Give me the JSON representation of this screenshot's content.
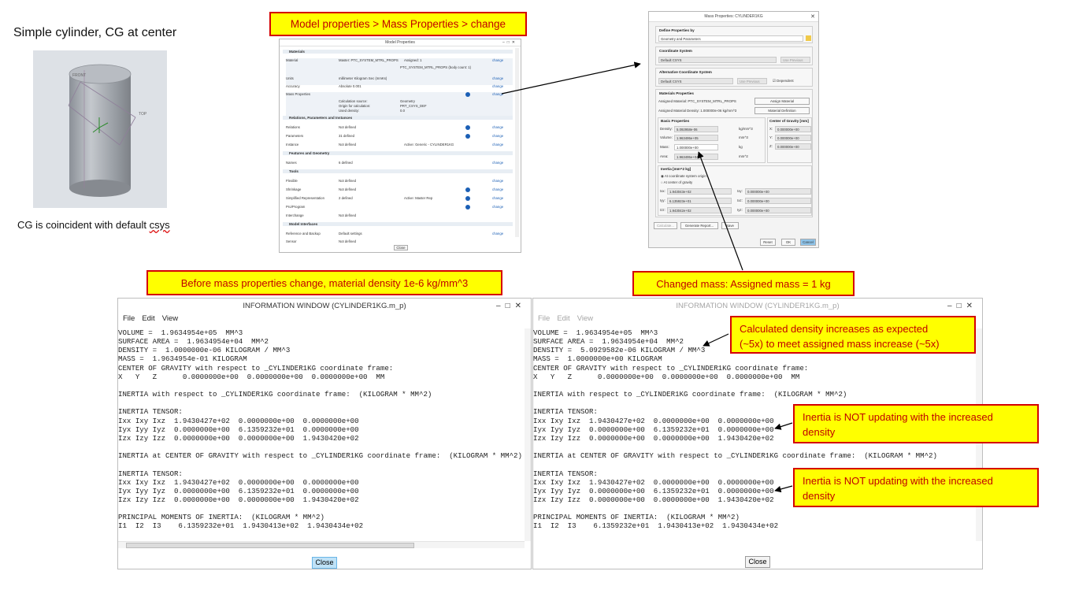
{
  "left_panel": {
    "heading": "Simple cylinder, CG at center",
    "caption_prefix": "CG is coincident with default ",
    "caption_suffix": "csys",
    "labels": {
      "top_plane": "TOP",
      "front_plane": "FRONT"
    }
  },
  "callouts": {
    "model_properties": "Model properties > Mass Properties > change",
    "before_change": "Before mass properties change, material density 1e-6 kg/mm^3",
    "changed_mass": "Changed mass: Assigned mass = 1 kg",
    "density_increase_1": "Calculated density increases as expected",
    "density_increase_2": "(~5x) to meet assigned mass increase (~5x)",
    "inertia_not_updating_1a": "Inertia is NOT updating with the increased",
    "inertia_not_updating_1b": "density",
    "inertia_not_updating_2a": "Inertia is NOT updating with the increased",
    "inertia_not_updating_2b": "density"
  },
  "model_properties": {
    "title": "Model Properties",
    "sections": {
      "materials": "Materials",
      "relations": "Relations, Parameters and Instances",
      "features": "Features and Geometry",
      "tools": "Tools",
      "interfaces": "Model Interfaces"
    },
    "rows": {
      "material": {
        "label": "Material",
        "value": "Master: PTC_SYSTEM_MTRL_PROPS",
        "extra": "Assigned: 1",
        "sub": "PTC_SYSTEM_MTRL_PROPS (body count: 1)"
      },
      "units": {
        "label": "Units",
        "value": "millimeter Kilogram Sec (mmKs)"
      },
      "accuracy": {
        "label": "Accuracy",
        "value": "Absolute 0.001"
      },
      "mass": {
        "label": "Mass Properties",
        "calc_label": "Calculation source:",
        "calc_value": "Geometry",
        "origin_label": "Origin for calculation:",
        "origin_value": "PRT_CSYS_DEF",
        "density_label": "Used density:",
        "density_value": "0.0"
      },
      "relations": {
        "label": "Relations",
        "value": "Not defined"
      },
      "parameters": {
        "label": "Parameters",
        "value": "31 defined"
      },
      "instance": {
        "label": "Instance",
        "value": "Not defined",
        "extra": "Active: Generic - CYLINDER1KG"
      },
      "names": {
        "label": "Names",
        "value": "6 defined"
      },
      "flexible": {
        "label": "Flexible",
        "value": "Not defined"
      },
      "shrinkage": {
        "label": "Shrinkage",
        "value": "Not defined"
      },
      "simplified": {
        "label": "Simplified Representation",
        "value": "2 defined",
        "extra": "Active: Master Rep"
      },
      "proprogram": {
        "label": "Pro/Program",
        "value": ""
      },
      "interchange": {
        "label": "Interchange",
        "value": "Not defined"
      },
      "reference": {
        "label": "Reference and Backup",
        "value": "Default settings"
      },
      "sensor": {
        "label": "Sensor",
        "value": "Not defined"
      }
    },
    "change_label": "change",
    "close_label": "Close"
  },
  "mass_dialog": {
    "title": "Mass Properties: CYLINDER1KG",
    "define_by_label": "Define Properties by",
    "define_by_value": "Geometry and Parameters",
    "csys_label": "Coordinate System",
    "csys_value": "Default CSYS",
    "csys_btn": "Use Previous",
    "alt_csys_label": "Alternative Coordinate System",
    "alt_csys_value": "Default CSYS",
    "alt_csys_btn": "Use Previous",
    "dependent_label": "Dependent",
    "mat_props_label": "Materials Properties",
    "assigned_material_label": "Assigned Material:",
    "assigned_material_value": "PTC_SYSTEM_MTRL_PROPS",
    "assign_material_btn": "Assign Material",
    "assigned_density_label": "Assigned Material Density:",
    "assigned_density_value": "1.000000e-06",
    "assigned_density_unit": "kg/mm^3",
    "material_def_btn": "Material Definition",
    "basic_label": "Basic Properties",
    "density_label": "Density:",
    "density_value": "5.092958e-06",
    "density_unit": "kg/mm^3",
    "volume_label": "Volume:",
    "volume_value": "1.963495e+05",
    "volume_unit": "mm^3",
    "mass_label": "Mass:",
    "mass_value": "1.000000e+00",
    "mass_unit": "kg",
    "area_label": "Area:",
    "area_value": "1.963495e+04",
    "area_unit": "mm^2",
    "cg_label": "Center of Gravity [mm]",
    "cg_x_label": "X:",
    "cg_x": "0.000000e+00",
    "cg_y_label": "Y:",
    "cg_y": "0.000000e+00",
    "cg_z_label": "Z:",
    "cg_z": "0.000000e+00",
    "inertia_label": "Inertia [mm^2 kg]",
    "radio_csys": "At coordinate system origin",
    "radio_cg": "At center of gravity",
    "ixx_label": "Ixx:",
    "ixx": "1.943043e+02",
    "ixy_label": "Ixy:",
    "ixy": "0.000000e+00",
    "iyy_label": "Iyy:",
    "iyy": "6.135923e+01",
    "ixz_label": "Ixz:",
    "ixz": "0.000000e+00",
    "izz_label": "Izz:",
    "izz": "1.943042e+02",
    "iyz_label": "Iyz:",
    "iyz": "0.000000e+00",
    "calculate_btn": "Calculate...",
    "report_btn": "Generate Report...",
    "save_btn": "Save",
    "reset_btn": "Reset",
    "ok_btn": "OK",
    "cancel_btn": "Cancel"
  },
  "info_left": {
    "title": "INFORMATION  WINDOW (CYLINDER1KG.m_p)",
    "menu": [
      "File",
      "Edit",
      "View"
    ],
    "lines": [
      "VOLUME =  1.9634954e+05  MM^3",
      "SURFACE AREA =  1.9634954e+04  MM^2",
      "DENSITY =  1.0000000e-06 KILOGRAM / MM^3",
      "MASS =  1.9634954e-01 KILOGRAM",
      "CENTER OF GRAVITY with respect to _CYLINDER1KG coordinate frame:",
      "X   Y   Z      0.0000000e+00  0.0000000e+00  0.0000000e+00  MM",
      "",
      "INERTIA with respect to _CYLINDER1KG coordinate frame:  (KILOGRAM * MM^2)",
      "",
      "INERTIA TENSOR:",
      "Ixx Ixy Ixz  1.9430427e+02  0.0000000e+00  0.0000000e+00",
      "Iyx Iyy Iyz  0.0000000e+00  6.1359232e+01  0.0000000e+00",
      "Izx Izy Izz  0.0000000e+00  0.0000000e+00  1.9430420e+02",
      "",
      "INERTIA at CENTER OF GRAVITY with respect to _CYLINDER1KG coordinate frame:  (KILOGRAM * MM^2)",
      "",
      "INERTIA TENSOR:",
      "Ixx Ixy Ixz  1.9430427e+02  0.0000000e+00  0.0000000e+00",
      "Iyx Iyy Iyz  0.0000000e+00  6.1359232e+01  0.0000000e+00",
      "Izx Izy Izz  0.0000000e+00  0.0000000e+00  1.9430420e+02",
      "",
      "PRINCIPAL MOMENTS OF INERTIA:  (KILOGRAM * MM^2)",
      "I1  I2  I3    6.1359232e+01  1.9430413e+02  1.9430434e+02"
    ],
    "close_label": "Close"
  },
  "info_right": {
    "title": "INFORMATION  WINDOW (CYLINDER1KG.m_p)",
    "menu": [
      "File",
      "Edit",
      "View"
    ],
    "lines": [
      "VOLUME =  1.9634954e+05  MM^3",
      "SURFACE AREA =  1.9634954e+04  MM^2",
      "DENSITY =  5.0929582e-06 KILOGRAM / MM^3",
      "MASS =  1.0000000e+00 KILOGRAM",
      "CENTER OF GRAVITY with respect to _CYLINDER1KG coordinate frame:",
      "X   Y   Z      0.0000000e+00  0.0000000e+00  0.0000000e+00  MM",
      "",
      "INERTIA with respect to _CYLINDER1KG coordinate frame:  (KILOGRAM * MM^2)",
      "",
      "INERTIA TENSOR:",
      "Ixx Ixy Ixz  1.9430427e+02  0.0000000e+00  0.0000000e+00",
      "Iyx Iyy Iyz  0.0000000e+00  6.1359232e+01  0.0000000e+00",
      "Izx Izy Izz  0.0000000e+00  0.0000000e+00  1.9430420e+02",
      "",
      "INERTIA at CENTER OF GRAVITY with respect to _CYLINDER1KG coordinate frame:  (KILOGRAM * MM^2)",
      "",
      "INERTIA TENSOR:",
      "Ixx Ixy Ixz  1.9430427e+02  0.0000000e+00  0.0000000e+00",
      "Iyx Iyy Iyz  0.0000000e+00  6.1359232e+01  0.0000000e+00",
      "Izx Izy Izz  0.0000000e+00  0.0000000e+00  1.9430420e+02",
      "",
      "PRINCIPAL MOMENTS OF INERTIA:  (KILOGRAM * MM^2)",
      "I1  I2  I3    6.1359232e+01  1.9430413e+02  1.9430434e+02"
    ],
    "close_label": "Close"
  },
  "colors": {
    "callout_bg": "#ffff00",
    "callout_border": "#d40000",
    "callout_text": "#c00000",
    "link": "#1b5fb5"
  }
}
